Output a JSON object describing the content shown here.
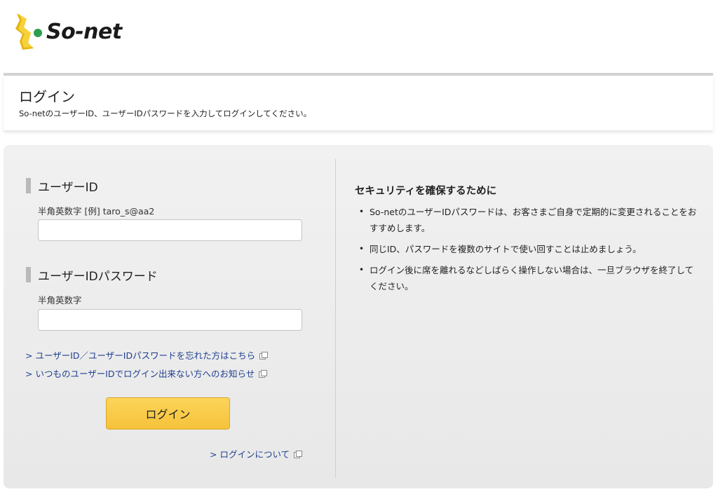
{
  "header": {
    "logo_text": "So-net",
    "logo_colors": {
      "mark": "#f4c20d",
      "dot": "#2e9d4f"
    }
  },
  "page": {
    "title": "ログイン",
    "subtitle": "So-netのユーザーID、ユーザーIDパスワードを入力してログインしてください。"
  },
  "form": {
    "userid_section": "ユーザーID",
    "userid_hint": "半角英数字 [例] taro_s@aa2",
    "userid_value": "",
    "password_section": "ユーザーIDパスワード",
    "password_hint": "半角英数字",
    "password_value": "",
    "forgot_link": "> ユーザーID／ユーザーIDパスワードを忘れた方はこちら",
    "cannot_login_link": "> いつものユーザーIDでログイン出来ない方へのお知らせ",
    "login_button": "ログイン",
    "about_link": "> ログインについて"
  },
  "security": {
    "title": "セキュリティを確保するために",
    "items": [
      "So-netのユーザーIDパスワードは、お客さまご自身で定期的に変更されることをおすすめします。",
      "同じID、パスワードを複数のサイトで使い回すことは止めましょう。",
      "ログイン後に席を離れるなどしばらく操作しない場合は、一旦ブラウザを終了してください。"
    ]
  },
  "colors": {
    "accent_button": "#f6c23a",
    "link": "#1f3f8f",
    "panel_bg": "#ececec"
  }
}
